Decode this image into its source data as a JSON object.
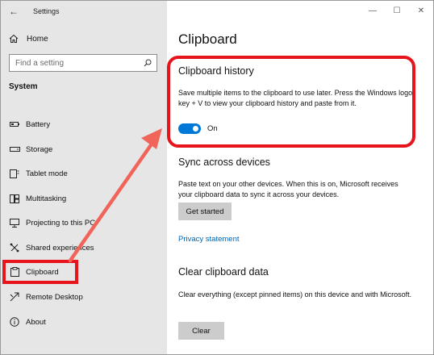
{
  "window": {
    "title": "Settings",
    "back_glyph": "←",
    "min_glyph": "—",
    "max_glyph": "☐",
    "close_glyph": "✕"
  },
  "sidebar": {
    "home_label": "Home",
    "search_placeholder": "Find a setting",
    "section_label": "System",
    "items": [
      {
        "label": "Battery",
        "icon": "battery-icon"
      },
      {
        "label": "Storage",
        "icon": "storage-icon"
      },
      {
        "label": "Tablet mode",
        "icon": "tablet-mode-icon"
      },
      {
        "label": "Multitasking",
        "icon": "multitasking-icon"
      },
      {
        "label": "Projecting to this PC",
        "icon": "projecting-icon"
      },
      {
        "label": "Shared experiences",
        "icon": "shared-experiences-icon"
      },
      {
        "label": "Clipboard",
        "icon": "clipboard-icon",
        "selected": true
      },
      {
        "label": "Remote Desktop",
        "icon": "remote-desktop-icon"
      },
      {
        "label": "About",
        "icon": "about-icon"
      }
    ]
  },
  "main": {
    "title": "Clipboard",
    "history": {
      "title": "Clipboard history",
      "description": "Save multiple items to the clipboard to use later. Press the Windows logo key + V to view your clipboard history and paste from it.",
      "toggle_state": "On"
    },
    "sync": {
      "title": "Sync across devices",
      "description": "Paste text on your other devices. When this is on, Microsoft receives your clipboard data to sync it across your devices.",
      "button_label": "Get started",
      "privacy_link": "Privacy statement"
    },
    "clear": {
      "title": "Clear clipboard data",
      "description": "Clear everything (except pinned items) on this device and with Microsoft.",
      "button_label": "Clear"
    }
  },
  "colors": {
    "accent": "#0078d7",
    "highlight": "#e8141c",
    "arrow": "#f0645a",
    "link": "#0063b1"
  }
}
